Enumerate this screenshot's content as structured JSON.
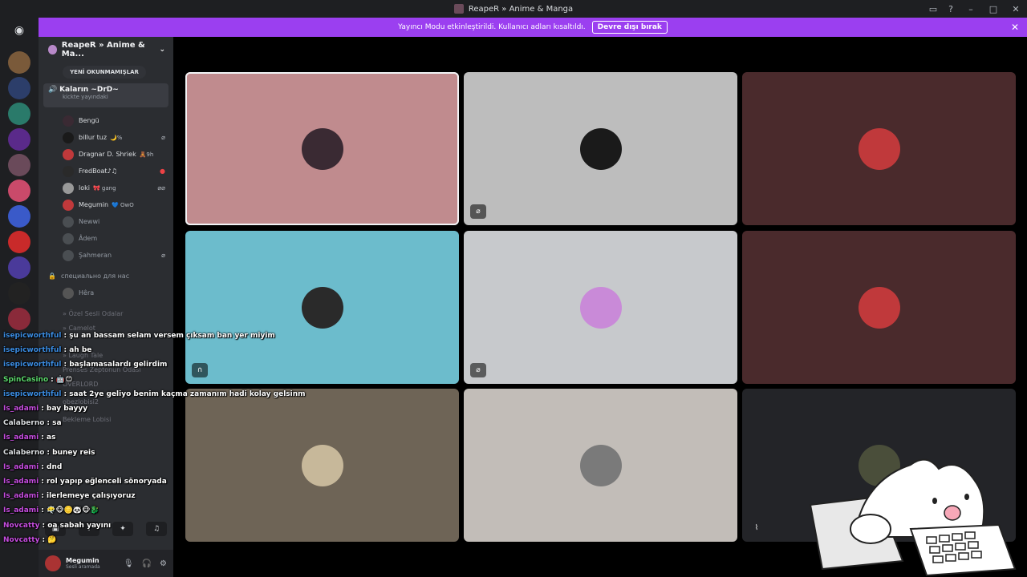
{
  "window": {
    "title": "ReapeR » Anime & Manga"
  },
  "banner": {
    "message": "Yayıncı Modu etkinleştirildi. Kullanıcı adları kısaltıldı.",
    "button_label": "Devre dışı bırak"
  },
  "guild": {
    "name": "ReapeR » Anime & Ma...",
    "unread_pill": "YENİ OKUNMAMIŞLAR"
  },
  "voice_channel": {
    "name": "Kaların ~DrD~",
    "status": "kickte yayındaki"
  },
  "members": [
    {
      "name": "Bengü",
      "badge": ""
    },
    {
      "name": "billur tuz",
      "badge": "🌙%"
    },
    {
      "name": "Dragnar D. Shriek",
      "badge": "🧸9h"
    },
    {
      "name": "FredBoat♪♫",
      "badge": ""
    },
    {
      "name": "loki",
      "badge": "🎀 gang"
    },
    {
      "name": "Megumin",
      "badge": "💙 OwO"
    },
    {
      "name": "Newwi",
      "badge": ""
    },
    {
      "name": "Âdem",
      "badge": ""
    },
    {
      "name": "Şahmeran",
      "badge": ""
    }
  ],
  "locked_channel": {
    "name": "специально для нас",
    "member": "Hêra"
  },
  "other_channels": [
    "» Özel Sesli Odalar",
    "» Camelot",
    "» Laugh Tale",
    "Prenses Zeptonun Odası",
    "OVERLORD",
    "obezlobisi2",
    "Bekleme Lobisi"
  ],
  "user_panel": {
    "name": "Megumin",
    "status": "Sesli aramada"
  },
  "chat_overlay": [
    {
      "user": "isepicworthful",
      "text": ": şu an bassam selam versem çıksam ban yer miyim",
      "color": "#3b8de3"
    },
    {
      "user": "isepicworthful",
      "text": ": ah be",
      "color": "#3b8de3"
    },
    {
      "user": "isepicworthful",
      "text": ": başlamasalardı gelirdim",
      "color": "#3b8de3"
    },
    {
      "user": "SpinCasino",
      "text": ": 🤖😊",
      "color": "#5bd66b"
    },
    {
      "user": "isepicworthful",
      "text": ": saat 2ye geliyo benim kaçma zamanım hadi kolay gelsinm",
      "color": "#3b8de3"
    },
    {
      "user": "Is_adami",
      "text": ": bay bayyy",
      "color": "#c64de0"
    },
    {
      "user": "Calaberno",
      "text": ": sa",
      "color": "#dbdee1"
    },
    {
      "user": "Is_adami",
      "text": ": as",
      "color": "#c64de0"
    },
    {
      "user": "Calaberno",
      "text": ": buney reis",
      "color": "#dbdee1"
    },
    {
      "user": "Is_adami",
      "text": ": dnd",
      "color": "#c64de0"
    },
    {
      "user": "Is_adami",
      "text": ": rol yapıp eğlenceli sönoryada",
      "color": "#c64de0"
    },
    {
      "user": "Is_adami",
      "text": ": ilerlemeye çalışıyoruz",
      "color": "#c64de0"
    },
    {
      "user": "Is_adami",
      "text": ": 😶‍🌫️🐵🪙🐼🐵🐉",
      "color": "#c64de0"
    },
    {
      "user": "Novcatty",
      "text": ": oa sabah yayını",
      "color": "#c64de0"
    },
    {
      "user": "Novcatty",
      "text": ": 🤔",
      "color": "#c64de0"
    }
  ],
  "tiles": [
    {
      "bg": "#c08b8e",
      "avatar": "#3a2a33",
      "icon": ""
    },
    {
      "bg": "#bdbdbd",
      "avatar": "#1a1a1a",
      "icon": "🎤̸"
    },
    {
      "bg": "#4a2a2c",
      "avatar": "#c0393b",
      "icon": ""
    },
    {
      "bg": "#6cbccc",
      "avatar": "#2a2a2a",
      "icon": "🎧"
    },
    {
      "bg": "#c7c9cc",
      "avatar": "#c98ad8",
      "icon": "🎤̸"
    },
    {
      "bg": "#4a2a2c",
      "avatar": "#c0393b",
      "icon": ""
    },
    {
      "bg": "#6e6456",
      "avatar": "#c7b89a",
      "icon": ""
    },
    {
      "bg": "#c2bdb8",
      "avatar": "#7a7a7a",
      "icon": ""
    },
    {
      "bg": "#232428",
      "avatar": "#4a4e3a",
      "icon": "🎤"
    }
  ]
}
